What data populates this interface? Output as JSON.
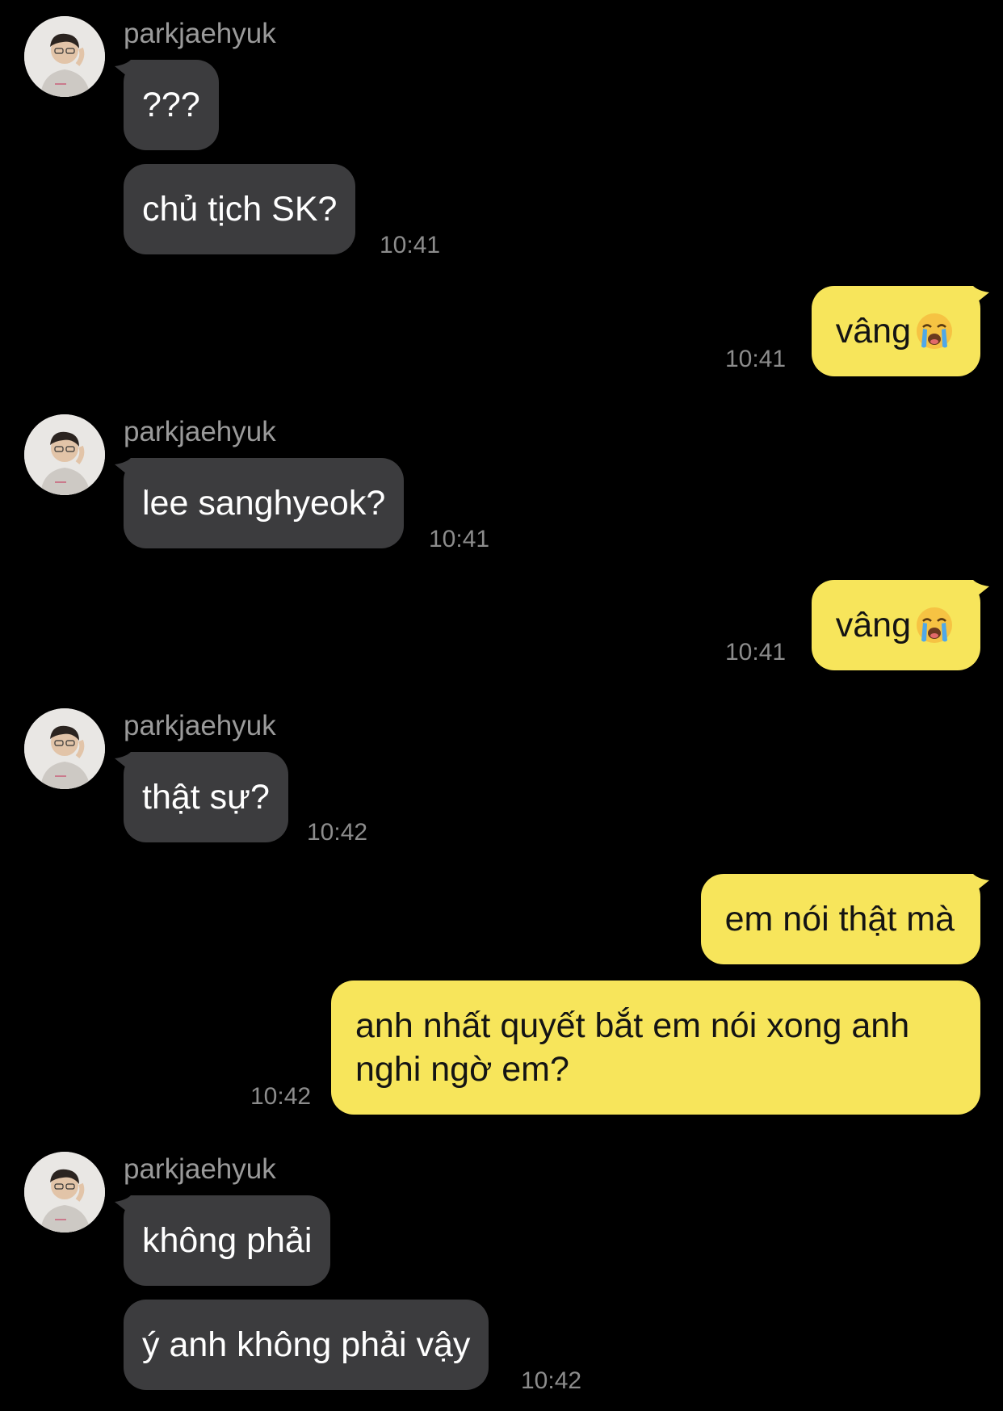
{
  "chat": {
    "sender_name": "parkjaehyuk",
    "messages": [
      {
        "from": "parkjaehyuk",
        "text": "???"
      },
      {
        "from": "parkjaehyuk",
        "text": "chủ tịch SK?",
        "time": "10:41"
      },
      {
        "from": "me",
        "text": "vâng",
        "emoji": "loudly-crying-face",
        "time": "10:41"
      },
      {
        "from": "parkjaehyuk",
        "text": "lee sanghyeok?",
        "time": "10:41"
      },
      {
        "from": "me",
        "text": "vâng",
        "emoji": "loudly-crying-face",
        "time": "10:41"
      },
      {
        "from": "parkjaehyuk",
        "text": "thật sự?",
        "time": "10:42"
      },
      {
        "from": "me",
        "text": "em nói thật mà"
      },
      {
        "from": "me",
        "text": "anh nhất quyết bắt em nói xong anh nghi ngờ em?",
        "time": "10:42"
      },
      {
        "from": "parkjaehyuk",
        "text": "không phải"
      },
      {
        "from": "parkjaehyuk",
        "text": "ý anh không phải vậy",
        "time": "10:42"
      }
    ]
  },
  "colors": {
    "background": "#000000",
    "incoming_bubble": "#3c3c3e",
    "outgoing_bubble": "#f7e55b",
    "timestamp": "#8c8c8c",
    "sender_name": "#9a9a9a"
  }
}
